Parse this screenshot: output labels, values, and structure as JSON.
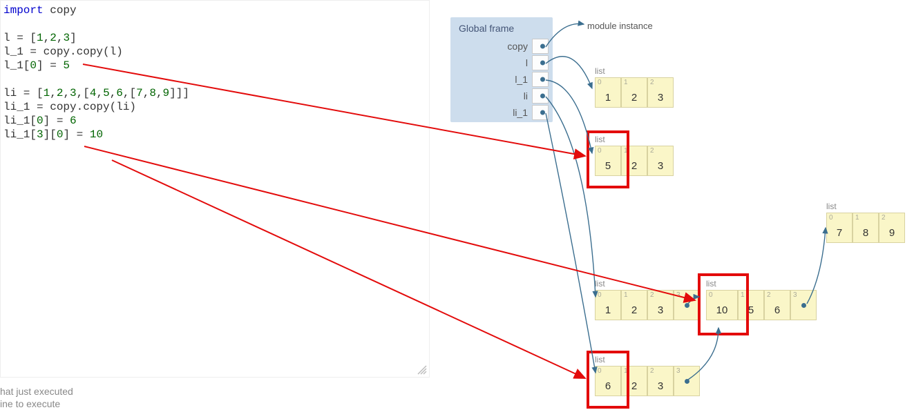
{
  "code": {
    "line1_a": "import",
    "line1_b": " copy",
    "line3_a": "l = [",
    "line3_b": "1",
    "line3_c": ",",
    "line3_d": "2",
    "line3_e": ",",
    "line3_f": "3",
    "line3_g": "]",
    "line4": "l_1 = copy.copy(l)",
    "line5_a": "l_1[",
    "line5_b": "0",
    "line5_c": "] = ",
    "line5_d": "5",
    "line7_a": "li = [",
    "line7_b": "1",
    "line7_c": ",",
    "line7_d": "2",
    "line7_e": ",",
    "line7_f": "3",
    "line7_g": ",[",
    "line7_h": "4",
    "line7_i": ",",
    "line7_j": "5",
    "line7_k": ",",
    "line7_l": "6",
    "line7_m": ",[",
    "line7_n": "7",
    "line7_o": ",",
    "line7_p": "8",
    "line7_q": ",",
    "line7_r": "9",
    "line7_s": "]]]",
    "line8": "li_1 = copy.copy(li)",
    "line9_a": "li_1[",
    "line9_b": "0",
    "line9_c": "] = ",
    "line9_d": "6",
    "line10_a": "li_1[",
    "line10_b": "3",
    "line10_c": "][",
    "line10_d": "0",
    "line10_e": "] = ",
    "line10_f": "10"
  },
  "status": {
    "l1": "hat just executed",
    "l2": "ine to execute"
  },
  "frame": {
    "title": "Global frame",
    "vars": [
      "copy",
      "l",
      "l_1",
      "li",
      "li_1"
    ]
  },
  "ann": {
    "module": "module instance",
    "list": "list"
  },
  "lists": {
    "l": {
      "idx": [
        "0",
        "1",
        "2"
      ],
      "val": [
        "1",
        "2",
        "3"
      ]
    },
    "l_1": {
      "idx": [
        "0",
        "1",
        "2"
      ],
      "val": [
        "5",
        "2",
        "3"
      ]
    },
    "li": {
      "idx": [
        "0",
        "1",
        "2",
        "3"
      ],
      "val": [
        "1",
        "2",
        "3",
        ""
      ]
    },
    "inner": {
      "idx": [
        "0",
        "1",
        "2",
        "3"
      ],
      "val": [
        "10",
        "5",
        "6",
        ""
      ]
    },
    "li_1": {
      "idx": [
        "0",
        "1",
        "2",
        "3"
      ],
      "val": [
        "6",
        "2",
        "3",
        ""
      ]
    },
    "deep": {
      "idx": [
        "0",
        "1",
        "2"
      ],
      "val": [
        "7",
        "8",
        "9"
      ]
    }
  }
}
